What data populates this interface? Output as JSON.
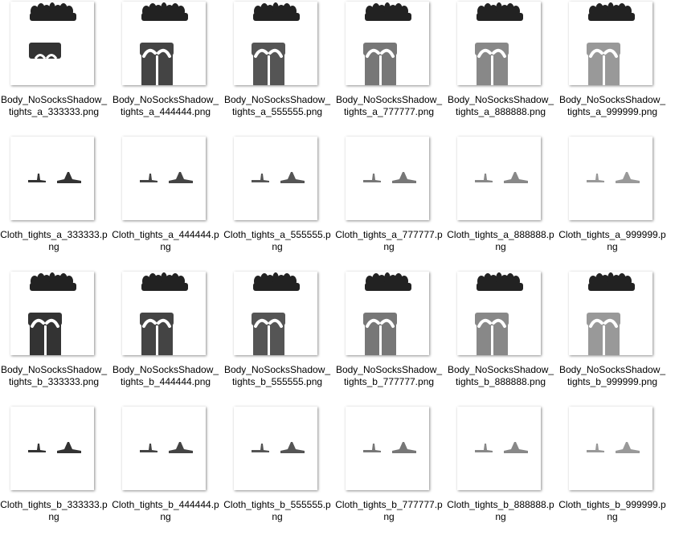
{
  "rows": [
    {
      "kind": "body",
      "items": [
        {
          "label": "Body_NoSocksShadow_tights_a_333333.png",
          "color": "#333333",
          "variant": "a",
          "style": "body-a-short"
        },
        {
          "label": "Body_NoSocksShadow_tights_a_444444.png",
          "color": "#444444",
          "variant": "a",
          "style": "body"
        },
        {
          "label": "Body_NoSocksShadow_tights_a_555555.png",
          "color": "#555555",
          "variant": "a",
          "style": "body"
        },
        {
          "label": "Body_NoSocksShadow_tights_a_777777.png",
          "color": "#777777",
          "variant": "a",
          "style": "body"
        },
        {
          "label": "Body_NoSocksShadow_tights_a_888888.png",
          "color": "#888888",
          "variant": "a",
          "style": "body"
        },
        {
          "label": "Body_NoSocksShadow_tights_a_999999.png",
          "color": "#999999",
          "variant": "a",
          "style": "body"
        }
      ]
    },
    {
      "kind": "cloth",
      "items": [
        {
          "label": "Cloth_tights_a_333333.png",
          "color": "#333333"
        },
        {
          "label": "Cloth_tights_a_444444.png",
          "color": "#444444"
        },
        {
          "label": "Cloth_tights_a_555555.png",
          "color": "#555555"
        },
        {
          "label": "Cloth_tights_a_777777.png",
          "color": "#777777"
        },
        {
          "label": "Cloth_tights_a_888888.png",
          "color": "#888888"
        },
        {
          "label": "Cloth_tights_a_999999.png",
          "color": "#999999"
        }
      ]
    },
    {
      "kind": "body",
      "items": [
        {
          "label": "Body_NoSocksShadow_tights_b_333333.png",
          "color": "#333333",
          "variant": "b",
          "style": "body"
        },
        {
          "label": "Body_NoSocksShadow_tights_b_444444.png",
          "color": "#444444",
          "variant": "b",
          "style": "body"
        },
        {
          "label": "Body_NoSocksShadow_tights_b_555555.png",
          "color": "#555555",
          "variant": "b",
          "style": "body"
        },
        {
          "label": "Body_NoSocksShadow_tights_b_777777.png",
          "color": "#777777",
          "variant": "b",
          "style": "body"
        },
        {
          "label": "Body_NoSocksShadow_tights_b_888888.png",
          "color": "#888888",
          "variant": "b",
          "style": "body"
        },
        {
          "label": "Body_NoSocksShadow_tights_b_999999.png",
          "color": "#999999",
          "variant": "b",
          "style": "body"
        }
      ]
    },
    {
      "kind": "cloth",
      "items": [
        {
          "label": "Cloth_tights_b_333333.png",
          "color": "#333333"
        },
        {
          "label": "Cloth_tights_b_444444.png",
          "color": "#444444"
        },
        {
          "label": "Cloth_tights_b_555555.png",
          "color": "#555555"
        },
        {
          "label": "Cloth_tights_b_777777.png",
          "color": "#777777"
        },
        {
          "label": "Cloth_tights_b_888888.png",
          "color": "#888888"
        },
        {
          "label": "Cloth_tights_b_999999.png",
          "color": "#999999"
        }
      ]
    }
  ],
  "colors": {
    "hands": "#222222",
    "background": "#ffffff",
    "shadow": "#888888"
  }
}
